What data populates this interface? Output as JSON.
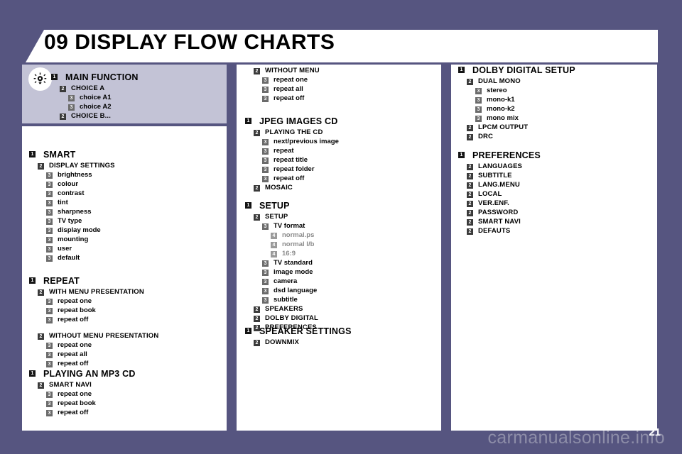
{
  "header": {
    "chapter": "09",
    "title": "DISPLAY FLOW CHARTS",
    "full_title": "09 DISPLAY FLOW CHARTS"
  },
  "legend": {
    "icon": "light-bulb-icon",
    "nodes": [
      {
        "level": 1,
        "badge": "1",
        "label": "MAIN FUNCTION"
      },
      {
        "level": 2,
        "badge": "2",
        "label": "CHOICE A"
      },
      {
        "level": 3,
        "badge": "3",
        "label": "choice A1"
      },
      {
        "level": 3,
        "badge": "3",
        "label": "choice A2"
      },
      {
        "level": 2,
        "badge": "2",
        "label": "CHOICE B..."
      }
    ]
  },
  "columns": {
    "left": [
      {
        "id": "smart",
        "nodes": [
          {
            "level": 1,
            "badge": "1",
            "label": "SMART"
          },
          {
            "level": 2,
            "badge": "2",
            "label": "DISPLAY SETTINGS"
          },
          {
            "level": 3,
            "badge": "3",
            "label": "brightness"
          },
          {
            "level": 3,
            "badge": "3",
            "label": "colour"
          },
          {
            "level": 3,
            "badge": "3",
            "label": "contrast"
          },
          {
            "level": 3,
            "badge": "3",
            "label": "tint"
          },
          {
            "level": 3,
            "badge": "3",
            "label": "sharpness"
          },
          {
            "level": 3,
            "badge": "3",
            "label": "TV type"
          },
          {
            "level": 3,
            "badge": "3",
            "label": "display mode"
          },
          {
            "level": 3,
            "badge": "3",
            "label": "mounting"
          },
          {
            "level": 3,
            "badge": "3",
            "label": "user"
          },
          {
            "level": 3,
            "badge": "3",
            "label": "default"
          }
        ]
      },
      {
        "id": "repeat",
        "nodes": [
          {
            "level": 1,
            "badge": "1",
            "label": "REPEAT"
          },
          {
            "level": 2,
            "badge": "2",
            "label": "WITH MENU PRESENTATION"
          },
          {
            "level": 3,
            "badge": "3",
            "label": "repeat one"
          },
          {
            "level": 3,
            "badge": "3",
            "label": "repeat book"
          },
          {
            "level": 3,
            "badge": "3",
            "label": "repeat off"
          },
          {
            "level": 0,
            "badge": "",
            "label": ""
          },
          {
            "level": 2,
            "badge": "2",
            "label": "WITHOUT MENU PRESENTATION"
          },
          {
            "level": 3,
            "badge": "3",
            "label": "repeat one"
          },
          {
            "level": 3,
            "badge": "3",
            "label": "repeat all"
          },
          {
            "level": 3,
            "badge": "3",
            "label": "repeat off"
          }
        ]
      },
      {
        "id": "mp3",
        "nodes": [
          {
            "level": 1,
            "badge": "1",
            "label": "PLAYING AN MP3 CD"
          },
          {
            "level": 2,
            "badge": "2",
            "label": "SMART NAVI"
          },
          {
            "level": 3,
            "badge": "3",
            "label": "repeat one"
          },
          {
            "level": 3,
            "badge": "3",
            "label": "repeat book"
          },
          {
            "level": 3,
            "badge": "3",
            "label": "repeat off"
          }
        ]
      }
    ],
    "middle": [
      {
        "id": "without-menu",
        "nodes": [
          {
            "level": 2,
            "badge": "2",
            "label": "WITHOUT MENU"
          },
          {
            "level": 3,
            "badge": "3",
            "label": "repeat one"
          },
          {
            "level": 3,
            "badge": "3",
            "label": "repeat all"
          },
          {
            "level": 3,
            "badge": "3",
            "label": "repeat off"
          }
        ]
      },
      {
        "id": "jpeg",
        "nodes": [
          {
            "level": 1,
            "badge": "1",
            "label": "JPEG IMAGES CD"
          },
          {
            "level": 2,
            "badge": "2",
            "label": "PLAYING THE CD"
          },
          {
            "level": 3,
            "badge": "3",
            "label": "next/previous image"
          },
          {
            "level": 3,
            "badge": "3",
            "label": "repeat"
          },
          {
            "level": 3,
            "badge": "3",
            "label": "repeat title"
          },
          {
            "level": 3,
            "badge": "3",
            "label": "repeat folder"
          },
          {
            "level": 3,
            "badge": "3",
            "label": "repeat off"
          },
          {
            "level": 2,
            "badge": "2",
            "label": "MOSAIC"
          }
        ]
      },
      {
        "id": "setup",
        "nodes": [
          {
            "level": 1,
            "badge": "1",
            "label": "SETUP"
          },
          {
            "level": 2,
            "badge": "2",
            "label": "SETUP"
          },
          {
            "level": 3,
            "badge": "3",
            "label": "TV format"
          },
          {
            "level": 4,
            "badge": "4",
            "label": "normal.ps"
          },
          {
            "level": 4,
            "badge": "4",
            "label": "normal l/b"
          },
          {
            "level": 4,
            "badge": "4",
            "label": "16:9"
          },
          {
            "level": 3,
            "badge": "3",
            "label": "TV standard"
          },
          {
            "level": 3,
            "badge": "3",
            "label": "image mode"
          },
          {
            "level": 3,
            "badge": "3",
            "label": "camera"
          },
          {
            "level": 3,
            "badge": "3",
            "label": "dsd language"
          },
          {
            "level": 3,
            "badge": "3",
            "label": "subtitle"
          },
          {
            "level": 2,
            "badge": "2",
            "label": "SPEAKERS"
          },
          {
            "level": 2,
            "badge": "2",
            "label": "DOLBY DIGITAL"
          },
          {
            "level": 2,
            "badge": "2",
            "label": "PREFERENCES"
          }
        ]
      },
      {
        "id": "speaker",
        "nodes": [
          {
            "level": 1,
            "badge": "1",
            "label": "SPEAKER SETTINGS"
          },
          {
            "level": 2,
            "badge": "2",
            "label": "DOWNMIX"
          }
        ]
      }
    ],
    "right": [
      {
        "id": "dolby",
        "nodes": [
          {
            "level": 1,
            "badge": "1",
            "label": "DOLBY DIGITAL SETUP"
          },
          {
            "level": 2,
            "badge": "2",
            "label": "DUAL MONO"
          },
          {
            "level": 3,
            "badge": "3",
            "label": "stereo"
          },
          {
            "level": 3,
            "badge": "3",
            "label": "mono-k1"
          },
          {
            "level": 3,
            "badge": "3",
            "label": "mono-k2"
          },
          {
            "level": 3,
            "badge": "3",
            "label": "mono mix"
          },
          {
            "level": 2,
            "badge": "2",
            "label": "LPCM OUTPUT"
          },
          {
            "level": 2,
            "badge": "2",
            "label": "DRC"
          }
        ]
      },
      {
        "id": "prefs",
        "nodes": [
          {
            "level": 1,
            "badge": "1",
            "label": "PREFERENCES"
          },
          {
            "level": 2,
            "badge": "2",
            "label": "LANGUAGES"
          },
          {
            "level": 2,
            "badge": "2",
            "label": "SUBTITLE"
          },
          {
            "level": 2,
            "badge": "2",
            "label": "LANG.MENU"
          },
          {
            "level": 2,
            "badge": "2",
            "label": "LOCAL"
          },
          {
            "level": 2,
            "badge": "2",
            "label": "VER.ENF."
          },
          {
            "level": 2,
            "badge": "2",
            "label": "PASSWORD"
          },
          {
            "level": 2,
            "badge": "2",
            "label": "SMART NAVI"
          },
          {
            "level": 2,
            "badge": "2",
            "label": "DEFAUTS"
          }
        ]
      }
    ]
  },
  "footer": {
    "watermark": "carmanualsonline.info",
    "page_number": "21"
  },
  "colors": {
    "background": "#565580",
    "panel": "#ffffff",
    "legend_panel": "#c3c3d6",
    "badge_l1": "#141414",
    "badge_l2": "#3a3a3a",
    "badge_l3": "#6b6b6b",
    "badge_l4": "#9a9a9a",
    "muted_text": "#8a8a8a",
    "watermark": "#8d8da8"
  }
}
